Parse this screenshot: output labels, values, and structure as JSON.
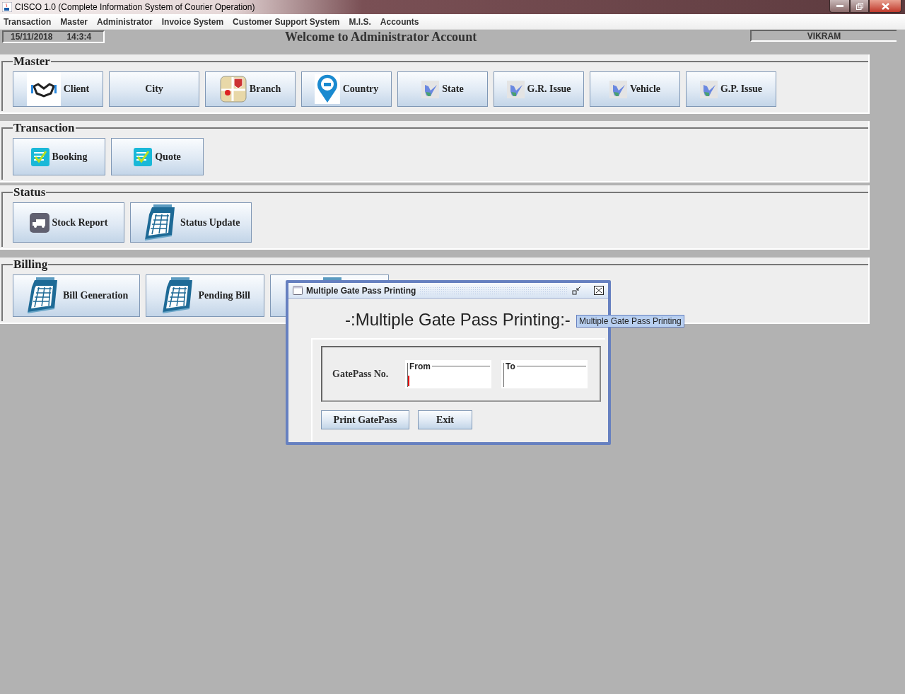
{
  "window": {
    "title": "CISCO 1.0 (Complete Information System of Courier Operation)"
  },
  "menu": [
    "Transaction",
    "Master",
    "Administrator",
    "Invoice System",
    "Customer Support System",
    "M.I.S.",
    "Accounts"
  ],
  "info_bar": {
    "date": "15/11/2018",
    "time": "14:3:4",
    "welcome": "Welcome to Administrator Account",
    "user": "VIKRAM"
  },
  "sections": [
    {
      "title": "Master",
      "buttons": [
        {
          "label": "Client",
          "kind": "handshake"
        },
        {
          "label": "City",
          "kind": "plain"
        },
        {
          "label": "Branch",
          "kind": "map"
        },
        {
          "label": "Country",
          "kind": "pin"
        },
        {
          "label": "State",
          "kind": "shape"
        },
        {
          "label": "G.R. Issue",
          "kind": "shape"
        },
        {
          "label": "Vehicle",
          "kind": "shape"
        },
        {
          "label": "G.P. Issue",
          "kind": "shape"
        }
      ]
    },
    {
      "title": "Transaction",
      "buttons": [
        {
          "label": "Booking",
          "kind": "checklist"
        },
        {
          "label": "Quote",
          "kind": "checklist"
        }
      ]
    },
    {
      "title": "Status",
      "buttons": [
        {
          "label": "Stock Report",
          "kind": "truck"
        },
        {
          "label": "Status Update",
          "kind": "calendar"
        }
      ]
    },
    {
      "title": "Billing",
      "buttons": [
        {
          "label": "Bill Generation",
          "kind": "calendar"
        },
        {
          "label": "Pending Bill",
          "kind": "calendar"
        },
        {
          "kind": "calendar"
        }
      ]
    }
  ],
  "dialog": {
    "title": "Multiple Gate Pass Printing",
    "heading": "-:Multiple Gate Pass Printing:-",
    "tooltip": "Multiple Gate Pass Printing",
    "field_label": "GatePass No.",
    "fields": [
      {
        "label": "From",
        "focused": true
      },
      {
        "label": "To",
        "focused": false
      }
    ],
    "buttons": [
      "Print GatePass",
      "Exit"
    ]
  }
}
